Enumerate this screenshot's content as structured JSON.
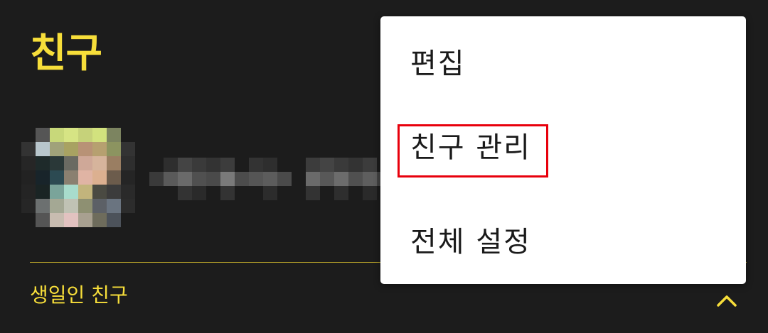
{
  "page": {
    "title": "친구"
  },
  "sections": {
    "birthday_label": "생일인 친구"
  },
  "menu": {
    "items": [
      {
        "label": "편집"
      },
      {
        "label": "친구 관리"
      },
      {
        "label": "전체 설정"
      }
    ],
    "highlighted_item": "친구 관리"
  },
  "colors": {
    "background": "#1c1c1c",
    "accent": "#f7de3a",
    "divider": "#b9a42a",
    "menu_background": "#ffffff",
    "menu_text": "#1a1a1a",
    "highlight": "#e8000c"
  },
  "icons": {
    "collapse": "chevron-up-icon"
  }
}
